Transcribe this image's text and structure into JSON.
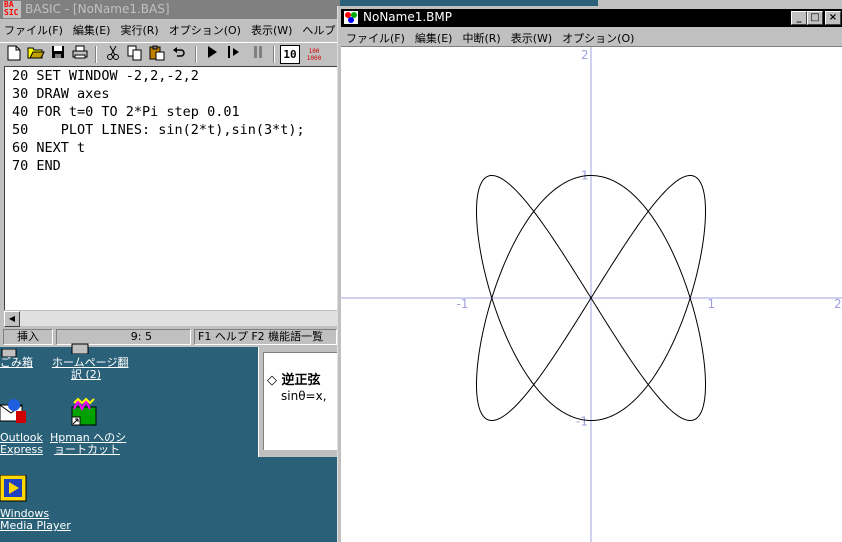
{
  "basic_window": {
    "title": "BASIC - [NoName1.BAS]",
    "app_icon_text": "BASIC",
    "menu": [
      "ファイル(F)",
      "編集(E)",
      "実行(R)",
      "オプション(O)",
      "表示(W)",
      "ヘルプ"
    ],
    "toolbar_icons": [
      "new-icon",
      "open-icon",
      "save-icon",
      "print-icon",
      "cut-icon",
      "copy-icon",
      "paste-icon",
      "undo-icon",
      "run-icon",
      "step-icon",
      "pause-icon",
      "number-icon",
      "renumber-icon"
    ],
    "toolbar_number_label": "10",
    "toolbar_renumber_label": "100 1000",
    "code_lines": [
      "20 SET WINDOW -2,2,-2,2",
      "30 DRAW axes",
      "40 FOR t=0 TO 2*Pi step 0.01",
      "50    PLOT LINES: sin(2*t),sin(3*t);",
      "60 NEXT t",
      "70 END"
    ],
    "status": {
      "mode": "挿入",
      "position": "9:  5",
      "help_hint": "F1 ヘルプ  F2 機能語一覧"
    }
  },
  "desktop": {
    "icons": [
      {
        "name": "recycle-bin",
        "label": "ごみ箱"
      },
      {
        "name": "homepage-translate",
        "label_line1": "ホームページ翻",
        "label_line2": "訳 (2)"
      },
      {
        "name": "outlook-express",
        "label_line1": "Outlook",
        "label_line2": "Express"
      },
      {
        "name": "hpman-shortcut",
        "label_line1": "Hpman へのシ",
        "label_line2": "ョートカット"
      },
      {
        "name": "windows-media-player",
        "label_line1": "Windows",
        "label_line2": "Media Player"
      }
    ]
  },
  "help_window": {
    "heading": "◇ 逆正弦",
    "formula": "sinθ=x,"
  },
  "bmp_window": {
    "title": "NoName1.BMP",
    "menu": [
      "ファイル(F)",
      "編集(E)",
      "中断(R)",
      "表示(W)",
      "オプション(O)"
    ],
    "buttons": {
      "minimize": "_",
      "maximize": "□",
      "close": "×"
    },
    "plot": {
      "xlim": [
        -2,
        2
      ],
      "ylim": [
        -2,
        2
      ],
      "tick_labels": {
        "y_top": "2",
        "y_pos1": "1",
        "y_neg1": "-1",
        "x_neg1": "-1",
        "x_pos1": "1",
        "x_right": "2"
      },
      "curve": "x = sin(2t), y = sin(3t), t from 0 to 2π step 0.01",
      "axis_color": "#a0a0e0",
      "curve_color": "#000000"
    }
  }
}
